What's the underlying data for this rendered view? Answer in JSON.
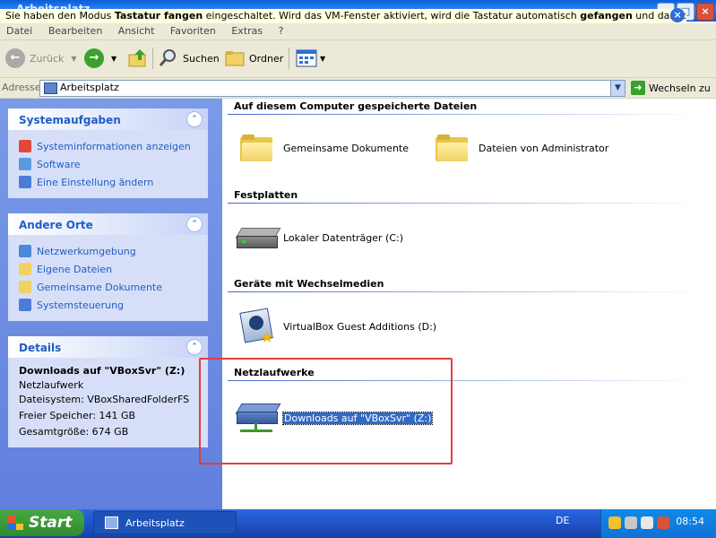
{
  "window": {
    "title": "Arbeitsplatz",
    "buttons": {
      "minimize": "_",
      "maximize": "□",
      "close": "×"
    }
  },
  "vm_notice": {
    "part1": "Sie haben den Modus ",
    "bold1": "Tastatur fangen",
    "part2": " eingeschaltet. Wird das VM-Fenster aktiviert, wird die Tastatur automatisch ",
    "bold2": "gefangen",
    "part3": " und damit für andere",
    "close_glyph": "×"
  },
  "menu": [
    "Datei",
    "Bearbeiten",
    "Ansicht",
    "Favoriten",
    "Extras",
    "?"
  ],
  "toolbar": {
    "back_label": "Zurück",
    "search_label": "Suchen",
    "folders_label": "Ordner"
  },
  "address": {
    "label": "Adresse",
    "value": "Arbeitsplatz",
    "go_label": "Wechseln zu"
  },
  "left": {
    "system_tasks": {
      "title": "Systemaufgaben",
      "items": [
        "Systeminformationen anzeigen",
        "Software",
        "Eine Einstellung ändern"
      ]
    },
    "other_places": {
      "title": "Andere Orte",
      "items": [
        "Netzwerkumgebung",
        "Eigene Dateien",
        "Gemeinsame Dokumente",
        "Systemsteuerung"
      ]
    },
    "details": {
      "title": "Details",
      "name": "Downloads auf \"VBoxSvr\" (Z:)",
      "type": "Netzlaufwerk",
      "filesystem": "Dateisystem: VBoxSharedFolderFS",
      "free": "Freier Speicher: 141 GB",
      "total": "Gesamtgröße: 674 GB"
    }
  },
  "content": {
    "sections": [
      {
        "title": "Auf diesem Computer gespeicherte Dateien",
        "items": [
          "Gemeinsame Dokumente",
          "Dateien von Administrator"
        ]
      },
      {
        "title": "Festplatten",
        "items": [
          "Lokaler Datenträger (C:)"
        ]
      },
      {
        "title": "Geräte mit Wechselmedien",
        "items": [
          "VirtualBox Guest Additions (D:)"
        ]
      },
      {
        "title": "Netzlaufwerke",
        "items": [
          "Downloads auf \"VBoxSvr\" (Z:)"
        ]
      }
    ]
  },
  "taskbar": {
    "start_label": "Start",
    "task_label": "Arbeitsplatz",
    "language": "DE",
    "clock": "08:54"
  }
}
